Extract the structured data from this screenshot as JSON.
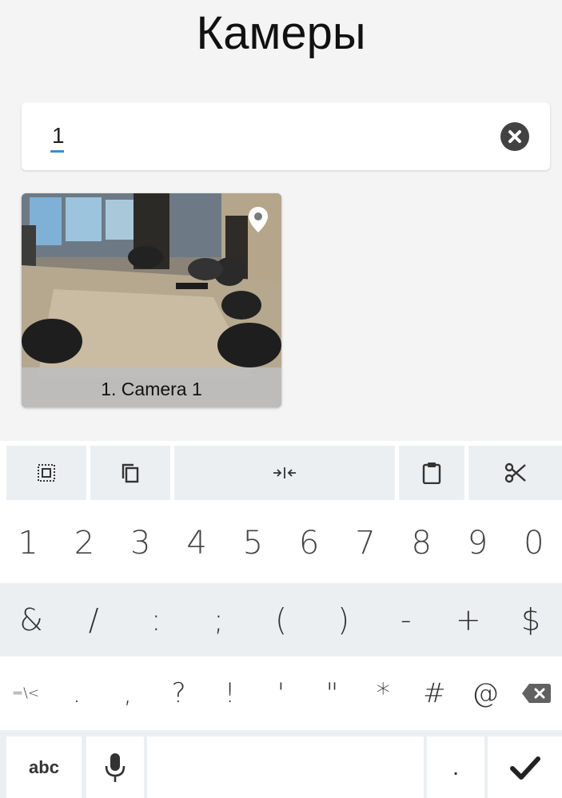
{
  "header": {
    "title": "Камеры"
  },
  "search": {
    "value": "1"
  },
  "cameras": [
    {
      "label": "1. Camera 1"
    }
  ],
  "clipboard_bar": {
    "icons": [
      "select-all-icon",
      "copy-icon",
      "cursor-move-icon",
      "paste-icon",
      "cut-icon"
    ]
  },
  "keyboard": {
    "row1": [
      "1",
      "2",
      "3",
      "4",
      "5",
      "6",
      "7",
      "8",
      "9",
      "0"
    ],
    "row2": [
      "&",
      "/",
      ":",
      ";",
      "(",
      ")",
      "-",
      "+",
      "$"
    ],
    "row3": [
      "=\\<",
      ".",
      ",",
      "?",
      "!",
      "'",
      "\"",
      "*",
      "#",
      "@"
    ],
    "abc_label": "abc",
    "period": "."
  },
  "colors": {
    "accent": "#3a8fd9",
    "key_bg_alt": "#eceff1"
  }
}
